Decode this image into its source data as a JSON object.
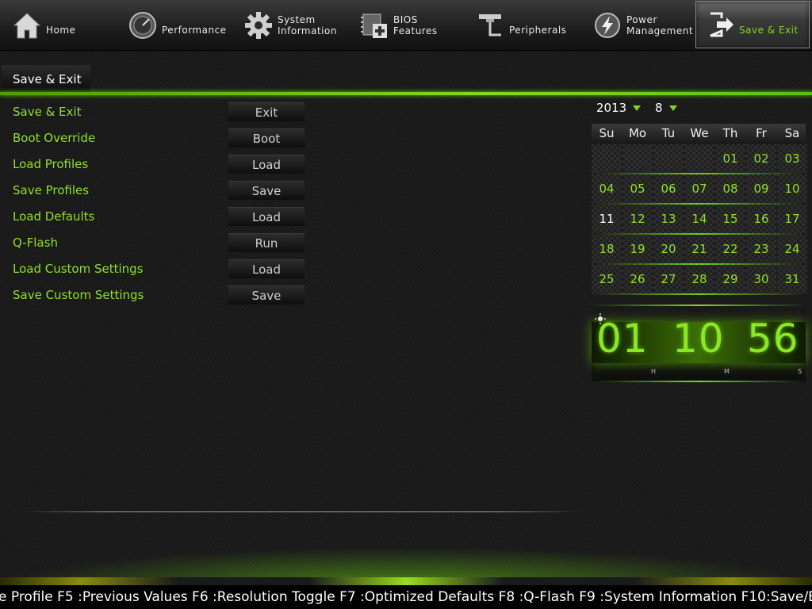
{
  "nav": [
    {
      "label": "Home",
      "icon": "home-icon"
    },
    {
      "label": "Performance",
      "icon": "gauge-icon"
    },
    {
      "label": "System\nInformation",
      "icon": "gear-icon"
    },
    {
      "label": "BIOS\nFeatures",
      "icon": "bios-features-icon"
    },
    {
      "label": "Peripherals",
      "icon": "peripherals-icon"
    },
    {
      "label": "Power\nManagement",
      "icon": "power-icon"
    },
    {
      "label": "Save & Exit",
      "icon": "exit-door-icon",
      "active": true
    }
  ],
  "tab": {
    "label": "Save & Exit"
  },
  "options": [
    {
      "label": "Save & Exit",
      "button": "Exit"
    },
    {
      "label": "Boot Override",
      "button": "Boot"
    },
    {
      "label": "Load Profiles",
      "button": "Load"
    },
    {
      "label": "Save Profiles",
      "button": "Save"
    },
    {
      "label": "Load Defaults",
      "button": "Load"
    },
    {
      "label": "Q-Flash",
      "button": "Run"
    },
    {
      "label": "Load Custom Settings",
      "button": "Load"
    },
    {
      "label": "Save Custom Settings",
      "button": "Save"
    }
  ],
  "calendar": {
    "year": "2013",
    "month": "8",
    "weekdays": [
      "Su",
      "Mo",
      "Tu",
      "We",
      "Th",
      "Fr",
      "Sa"
    ],
    "weeks": [
      [
        "",
        "",
        "",
        "",
        "01",
        "02",
        "03"
      ],
      [
        "04",
        "05",
        "06",
        "07",
        "08",
        "09",
        "10"
      ],
      [
        "11",
        "12",
        "13",
        "14",
        "15",
        "16",
        "17"
      ],
      [
        "18",
        "19",
        "20",
        "21",
        "22",
        "23",
        "24"
      ],
      [
        "25",
        "26",
        "27",
        "28",
        "29",
        "30",
        "31"
      ]
    ],
    "today": "11"
  },
  "clock": {
    "h": "01",
    "m": "10",
    "s": "56",
    "h_label": "H",
    "m_label": "M",
    "s_label": "S"
  },
  "hotkeys": "e Profile F5 :Previous Values F6 :Resolution Toggle F7 :Optimized Defaults F8 :Q-Flash F9 :System Information F10:Save/E",
  "colors": {
    "accent": "#7fd61c",
    "text_green": "#8fe11f",
    "background": "#171717"
  }
}
